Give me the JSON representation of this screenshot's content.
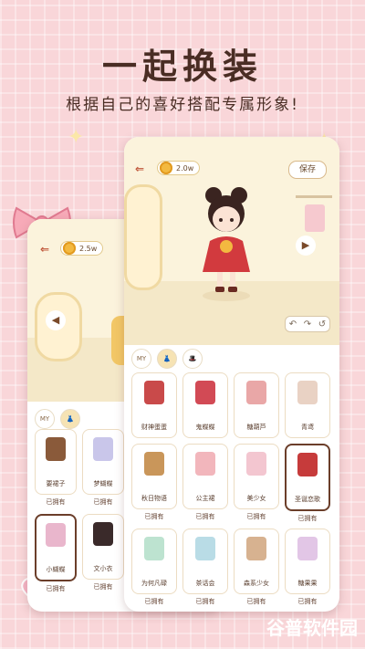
{
  "header": {
    "title": "一起换装",
    "subtitle": "根据自己的喜好搭配专属形象!"
  },
  "colors": {
    "accent": "#6b3e2a",
    "background": "#f9d6d9"
  },
  "front_phone": {
    "coin_amount": "2.0w",
    "save_label": "保存",
    "next_icon": "play-right-icon",
    "undo_controls": [
      "↶",
      "↷",
      "↺"
    ],
    "category_tabs": [
      "MY",
      "dress",
      "hat"
    ],
    "items": [
      {
        "label": "财神蛋蛋",
        "owned": "",
        "thumb_color": "#c94a4a"
      },
      {
        "label": "鬼蝶蝶",
        "owned": "",
        "thumb_color": "#d24a55"
      },
      {
        "label": "糖葫芦",
        "owned": "",
        "thumb_color": "#e9a7a7"
      },
      {
        "label": "青鸢",
        "owned": "",
        "thumb_color": "#e9d2c4"
      },
      {
        "label": "秋日物语",
        "owned": "已拥有",
        "thumb_color": "#c9965a"
      },
      {
        "label": "公主裙",
        "owned": "已拥有",
        "thumb_color": "#f2b6bc"
      },
      {
        "label": "美少女",
        "owned": "已拥有",
        "thumb_color": "#f3c6d0"
      },
      {
        "label": "圣诞恋歌",
        "owned": "已拥有",
        "thumb_color": "#c63b3b"
      },
      {
        "label": "为何凡碌",
        "owned": "已拥有",
        "thumb_color": "#bde3d0"
      },
      {
        "label": "茶话会",
        "owned": "已拥有",
        "thumb_color": "#b9dce6"
      },
      {
        "label": "森系少女",
        "owned": "已拥有",
        "thumb_color": "#d7b290"
      },
      {
        "label": "糖果果",
        "owned": "已拥有",
        "thumb_color": "#e2c6e6"
      }
    ],
    "row_owned": [
      "已拥有",
      "已拥有",
      "已拥有",
      "已拥有"
    ]
  },
  "back_phone": {
    "coin_amount": "2.5w",
    "category_tabs": [
      "MY",
      "dress"
    ],
    "items": [
      {
        "label": "要裙子",
        "owned": "已拥有",
        "thumb_color": "#8a5a3a"
      },
      {
        "label": "梦蝴蝶",
        "owned": "已拥有",
        "thumb_color": "#c9c6ea"
      },
      {
        "label": "小蝴蝶",
        "owned": "已拥有",
        "thumb_color": "#e9b6cc"
      },
      {
        "label": "文小衣",
        "owned": "已拥有",
        "thumb_color": "#3a2a2a"
      }
    ]
  },
  "watermark": "谷普软件园"
}
